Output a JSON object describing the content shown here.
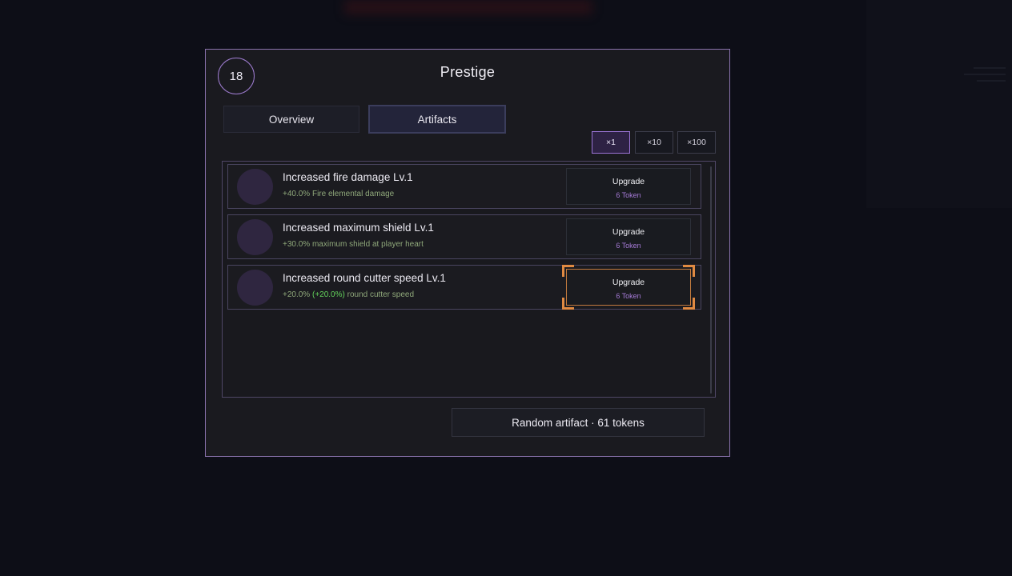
{
  "dialog": {
    "title": "Prestige",
    "level": "18"
  },
  "tabs": [
    {
      "label": "Overview",
      "active": false
    },
    {
      "label": "Artifacts",
      "active": true
    }
  ],
  "multipliers": [
    {
      "label": "×1",
      "selected": true
    },
    {
      "label": "×10",
      "selected": false
    },
    {
      "label": "×100",
      "selected": false
    }
  ],
  "artifacts": [
    {
      "name": "Increased fire damage Lv.1",
      "desc_prefix": "+40.0% Fire elemental damage",
      "desc_bonus": "",
      "desc_suffix": "",
      "button_label": "Upgrade",
      "cost": "6 Token"
    },
    {
      "name": "Increased maximum shield Lv.1",
      "desc_prefix": "+30.0% maximum shield at player heart",
      "desc_bonus": "",
      "desc_suffix": "",
      "button_label": "Upgrade",
      "cost": "6 Token"
    },
    {
      "name": "Increased round cutter speed Lv.1",
      "desc_prefix": "+20.0% ",
      "desc_bonus": "(+20.0%)",
      "desc_suffix": " round cutter speed",
      "button_label": "Upgrade",
      "cost": "6 Token"
    }
  ],
  "random_artifact": {
    "label": "Random artifact · 61 tokens"
  },
  "colors": {
    "accent_purple": "#9b74d6",
    "selection_orange": "#e08a42",
    "bonus_green": "#63d35b",
    "desc_green": "#8fa87a",
    "cost_purple": "#a57ad6"
  }
}
